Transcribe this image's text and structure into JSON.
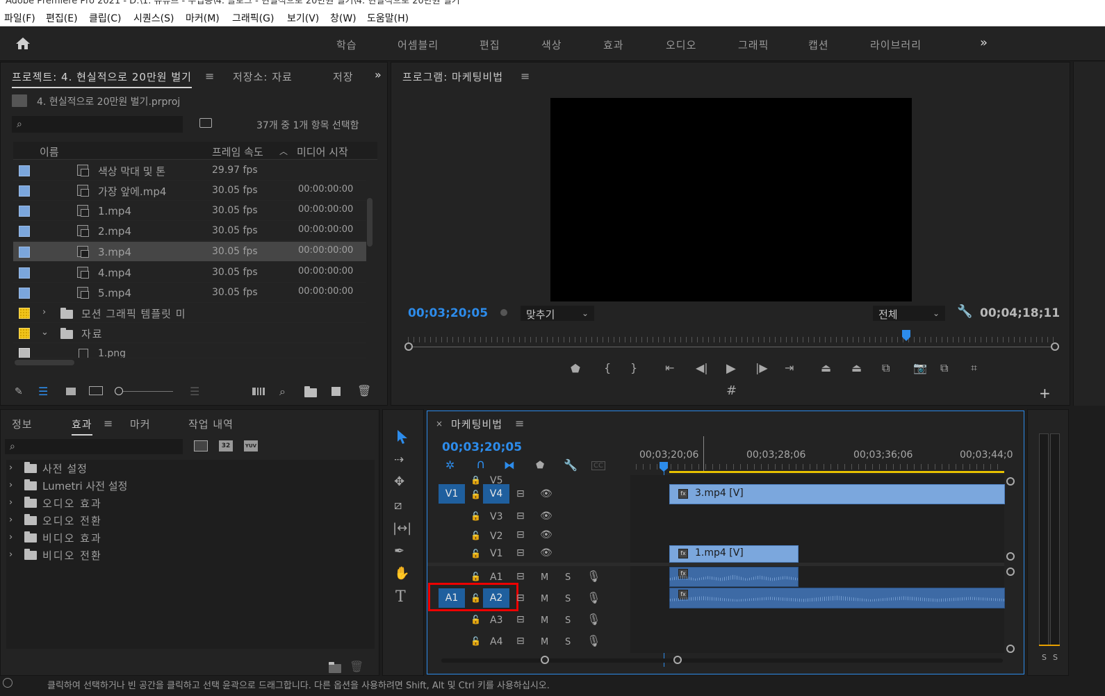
{
  "titlebar": {
    "text": "Adobe Premiere Pro 2021 - D:\\1. 유튜브 - 수업용\\4. 블로그 - 현실적으로 20만원 벌기\\4. 현실적으로 20만원 벌기"
  },
  "menu": [
    "파일(F)",
    "편집(E)",
    "클립(C)",
    "시퀀스(S)",
    "마커(M)",
    "그래픽(G)",
    "보기(V)",
    "창(W)",
    "도움말(H)"
  ],
  "workspaces": [
    "학습",
    "어셈블리",
    "편집",
    "색상",
    "효과",
    "오디오",
    "그래픽",
    "캡션",
    "라이브러리"
  ],
  "project": {
    "tab_project": "프로젝트: 4. 현실적으로 20만원 벌기",
    "tab_storage": "저장소: 자료",
    "tab_save": "저장",
    "file": "4. 현실적으로 20만원 벌기.prproj",
    "selection": "37개 중 1개 항목 선택함",
    "col_name": "이름",
    "col_fps": "프레임 속도",
    "col_start": "미디어 시작",
    "rows": [
      {
        "name": "색상 막대 및 톤",
        "fps": "29.97 fps",
        "start": ""
      },
      {
        "name": "가장 앞에.mp4",
        "fps": "30.05 fps",
        "start": "00:00:00:00"
      },
      {
        "name": "1.mp4",
        "fps": "30.05 fps",
        "start": "00:00:00:00"
      },
      {
        "name": "2.mp4",
        "fps": "30.05 fps",
        "start": "00:00:00:00"
      },
      {
        "name": "3.mp4",
        "fps": "30.05 fps",
        "start": "00:00:00:00"
      },
      {
        "name": "4.mp4",
        "fps": "30.05 fps",
        "start": "00:00:00:00"
      },
      {
        "name": "5.mp4",
        "fps": "30.05 fps",
        "start": "00:00:00:00"
      }
    ],
    "folders": [
      "모션 그래픽 템플릿 미",
      "자료"
    ],
    "sub_item": "1.png"
  },
  "program": {
    "title": "프로그램: 마케팅비법",
    "timecode": "00;03;20;05",
    "fit": "맞추기",
    "quality": "전체",
    "duration": "00;04;18;11"
  },
  "effects": {
    "tabs": [
      "정보",
      "효과",
      "마커",
      "작업 내역"
    ],
    "items": [
      "사전 설정",
      "Lumetri 사전 설정",
      "오디오 효과",
      "오디오 전환",
      "비디오 효과",
      "비디오 전환"
    ]
  },
  "timeline": {
    "title": "마케팅비법",
    "timecode": "00;03;20;05",
    "ruler": [
      "00;03;20;06",
      "00;03;28;06",
      "00;03;36;06",
      "00;03;44;0"
    ],
    "video_tracks": [
      "V5",
      "V4",
      "V3",
      "V2",
      "V1"
    ],
    "audio_tracks": [
      "A1",
      "A2",
      "A3",
      "A4"
    ],
    "src_v": "V1",
    "src_a": "A1",
    "clip_v4": "3.mp4 [V]",
    "clip_v1": "1.mp4 [V]",
    "m": "M",
    "s": "S"
  },
  "meter": {
    "s1": "S",
    "s2": "S"
  },
  "status": "클릭하여 선택하거나 빈 공간을 클릭하고 선택 윤곽으로 드래그합니다. 다른 옵션을 사용하려면 Shift, Alt 및 Ctrl 키를 사용하십시오."
}
